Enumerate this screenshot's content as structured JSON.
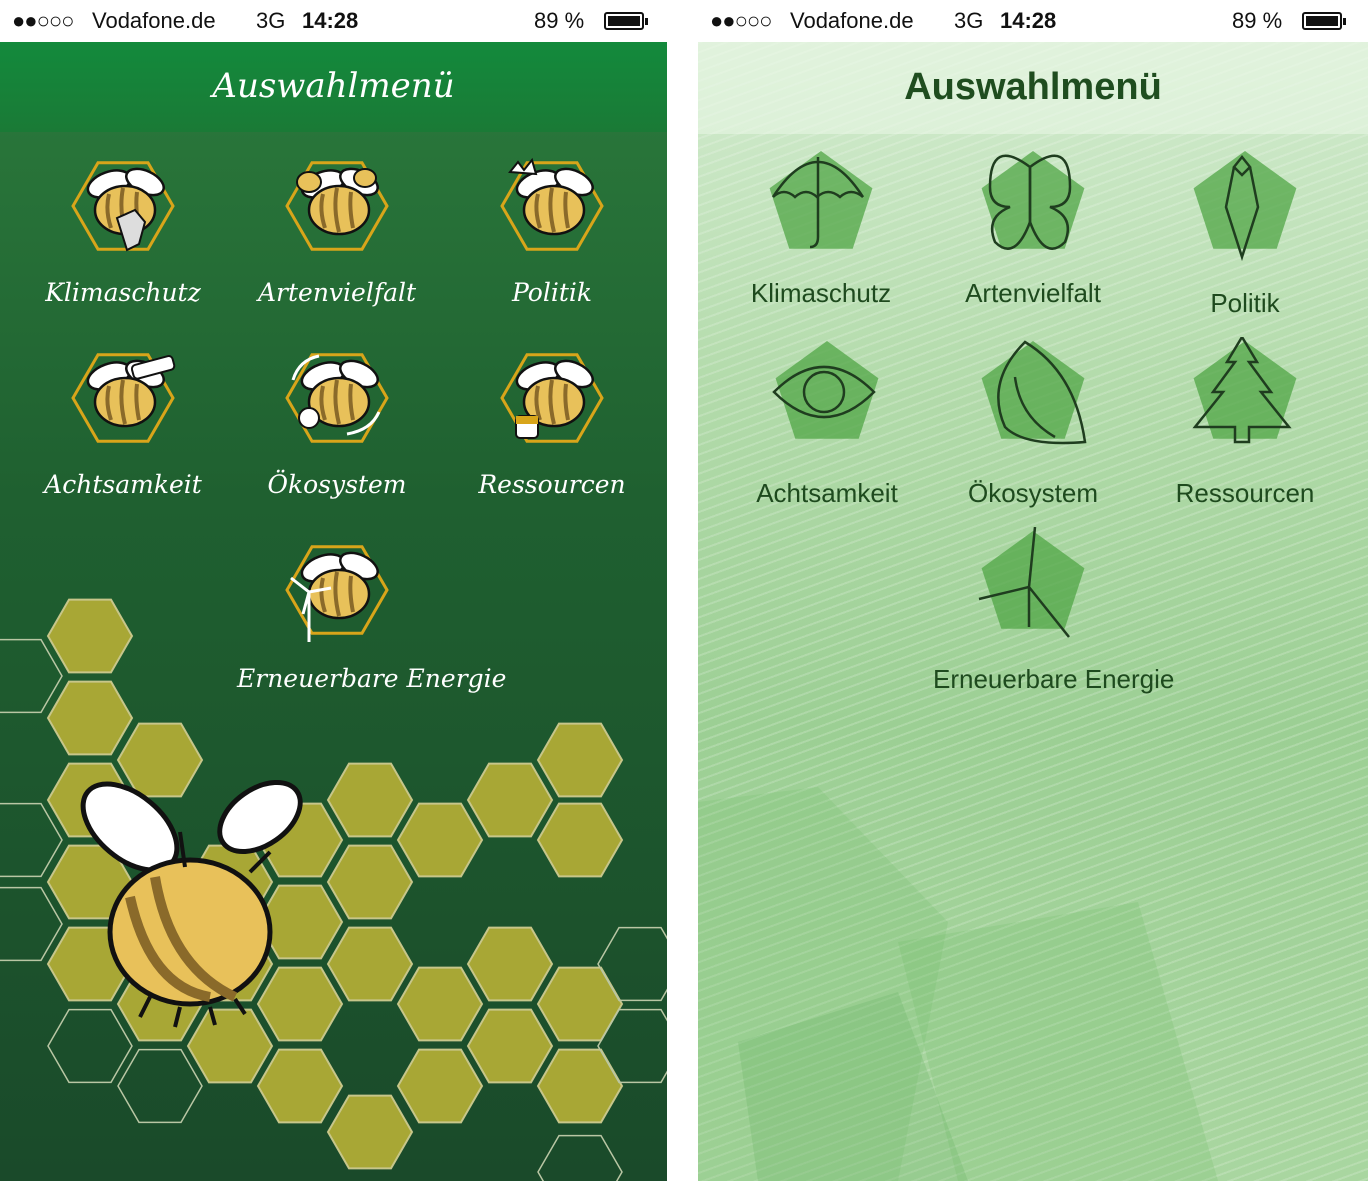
{
  "left_screen": {
    "status": {
      "signal": "●●○○○",
      "carrier": "Vodafone.de",
      "network": "3G",
      "time": "14:28",
      "battery": "89 %",
      "battery_level": 0.89
    },
    "title": "Auswahlmenü",
    "menu": [
      {
        "label": "Klimaschutz",
        "icon": "bee-shield-icon"
      },
      {
        "label": "Artenvielfalt",
        "icon": "three-bees-icon"
      },
      {
        "label": "Politik",
        "icon": "bee-crown-icon"
      },
      {
        "label": "Achtsamkeit",
        "icon": "bee-telescope-icon"
      },
      {
        "label": "Ökosystem",
        "icon": "bee-flower-cycle-icon"
      },
      {
        "label": "Ressourcen",
        "icon": "bee-honey-pot-icon"
      },
      {
        "label": "Erneuerbare Energie",
        "icon": "bee-wind-turbine-icon"
      }
    ],
    "colors": {
      "background": "#1f6030",
      "header": "#138a3c",
      "hexagon": "#a8a735",
      "hex_outline": "#d8a51a",
      "bee": "#e8c15a"
    }
  },
  "right_screen": {
    "status": {
      "signal": "●●○○○",
      "carrier": "Vodafone.de",
      "network": "3G",
      "time": "14:28",
      "battery": "89 %",
      "battery_level": 0.89
    },
    "title": "Auswahlmenü",
    "menu": [
      {
        "label": "Klimaschutz",
        "icon": "umbrella-icon"
      },
      {
        "label": "Artenvielfalt",
        "icon": "butterfly-icon"
      },
      {
        "label": "Politik",
        "icon": "fountain-pen-icon"
      },
      {
        "label": "Achtsamkeit",
        "icon": "eye-icon"
      },
      {
        "label": "Ökosystem",
        "icon": "leaf-icon"
      },
      {
        "label": "Ressourcen",
        "icon": "fir-tree-icon"
      },
      {
        "label": "Erneuerbare Energie",
        "icon": "wind-turbine-icon"
      }
    ],
    "colors": {
      "background": "#b3dbab",
      "pentagon": "#5fae54",
      "text": "#1e4a1e"
    }
  }
}
